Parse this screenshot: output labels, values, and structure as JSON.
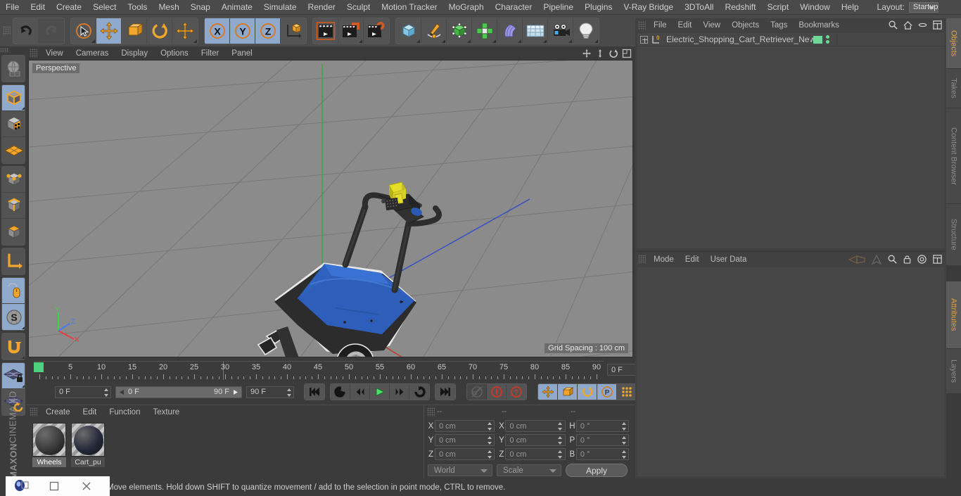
{
  "app": {
    "name": "CINEMA 4D",
    "brand": "MAXON",
    "brand_suffix": "CINEMA 4D"
  },
  "menubar": {
    "items": [
      "File",
      "Edit",
      "Create",
      "Select",
      "Tools",
      "Mesh",
      "Snap",
      "Animate",
      "Simulate",
      "Render",
      "Sculpt",
      "Motion Tracker",
      "MoGraph",
      "Character",
      "Pipeline",
      "Plugins",
      "V-Ray Bridge",
      "3DToAll",
      "Redshift",
      "Script",
      "Window",
      "Help"
    ],
    "layout_label": "Layout:",
    "layout_value": "Startup",
    "right_icons": [
      "search-icon",
      "home-icon",
      "minimize-icon",
      "maximize-icon"
    ]
  },
  "toolbar": {
    "groups": [
      {
        "name": "undo-redo",
        "buttons": [
          {
            "icon": "undo-icon",
            "label": "Undo",
            "state": "normal"
          },
          {
            "icon": "redo-icon",
            "label": "Redo",
            "state": "disabled"
          }
        ]
      },
      {
        "name": "transform-tools",
        "buttons": [
          {
            "icon": "live-selection-icon",
            "label": "Live Selection",
            "state": "normal",
            "has_corner": true
          },
          {
            "icon": "move-icon",
            "label": "Move",
            "state": "selected"
          },
          {
            "icon": "scale-icon",
            "label": "Scale",
            "state": "normal"
          },
          {
            "icon": "rotate-icon",
            "label": "Rotate",
            "state": "normal"
          },
          {
            "icon": "move-alt-icon",
            "label": "Move Tool",
            "state": "normal",
            "has_corner": true
          }
        ]
      },
      {
        "name": "axis-locks",
        "buttons": [
          {
            "icon": "axis-x-icon",
            "label": "X Axis",
            "state": "selected"
          },
          {
            "icon": "axis-y-icon",
            "label": "Y Axis",
            "state": "selected"
          },
          {
            "icon": "axis-z-icon",
            "label": "Z Axis",
            "state": "selected"
          },
          {
            "icon": "world-coordinates-icon",
            "label": "World / Object Coordinate System",
            "state": "normal"
          }
        ]
      },
      {
        "name": "render-tools",
        "buttons": [
          {
            "icon": "render-view-icon",
            "label": "Render View",
            "state": "normal"
          },
          {
            "icon": "render-region-icon",
            "label": "Render to Picture Viewer",
            "state": "normal",
            "has_corner": true
          },
          {
            "icon": "render-settings-icon",
            "label": "Edit Render Settings",
            "state": "normal"
          }
        ]
      },
      {
        "name": "create-objects",
        "buttons": [
          {
            "icon": "cube-primitive-icon",
            "label": "Add Cube Object",
            "state": "normal",
            "has_corner": true
          },
          {
            "icon": "spline-pen-icon",
            "label": "Add Spline",
            "state": "normal",
            "has_corner": true
          },
          {
            "icon": "generator-icon",
            "label": "Add Generator",
            "state": "normal",
            "has_corner": true
          },
          {
            "icon": "array-icon",
            "label": "Add Modeling Object",
            "state": "normal",
            "has_corner": true
          },
          {
            "icon": "deformer-icon",
            "label": "Add Bend Object",
            "state": "normal",
            "has_corner": true
          },
          {
            "icon": "environment-icon",
            "label": "Add Floor Object",
            "state": "normal",
            "has_corner": true
          },
          {
            "icon": "camera-icon",
            "label": "Add Camera",
            "state": "normal",
            "has_corner": true
          },
          {
            "icon": "light-icon",
            "label": "Add Light",
            "state": "normal",
            "has_corner": true
          }
        ]
      }
    ]
  },
  "left_toolbar": {
    "groups": [
      {
        "name": "viewport-modes",
        "buttons": [
          {
            "icon": "make-editable-icon",
            "label": "Make Editable",
            "state": "normal"
          }
        ]
      },
      {
        "name": "component-modes",
        "buttons": [
          {
            "icon": "model-mode-icon",
            "label": "Model Mode",
            "state": "selected",
            "has_corner": true
          },
          {
            "icon": "texture-mode-icon",
            "label": "Texture Mode",
            "state": "normal"
          },
          {
            "icon": "workplane-icon",
            "label": "Enable Workplane",
            "state": "normal"
          }
        ]
      },
      {
        "name": "element-modes",
        "buttons": [
          {
            "icon": "points-mode-icon",
            "label": "Points Mode",
            "state": "normal"
          },
          {
            "icon": "edges-mode-icon",
            "label": "Edges Mode",
            "state": "normal"
          },
          {
            "icon": "polygons-mode-icon",
            "label": "Polygons Mode",
            "state": "normal"
          }
        ]
      },
      {
        "name": "axis-mode",
        "buttons": [
          {
            "icon": "enable-axis-icon",
            "label": "Enable Axis Modification",
            "state": "normal"
          }
        ]
      },
      {
        "name": "snap-modes",
        "buttons": [
          {
            "icon": "viewport-solo-icon",
            "label": "Viewport Solo Single",
            "state": "selected"
          },
          {
            "icon": "snap-icon",
            "label": "Enable Snapping",
            "state": "selected",
            "has_corner": true
          }
        ]
      },
      {
        "name": "undo-view",
        "buttons": [
          {
            "icon": "undo-view-icon",
            "label": "Undo View",
            "state": "normal",
            "has_corner": true
          }
        ]
      },
      {
        "name": "workplane-tools",
        "buttons": [
          {
            "icon": "workplane-lock-icon",
            "label": "Lock Workplane",
            "state": "selected"
          },
          {
            "icon": "workplane-reset-icon",
            "label": "Planar Workplane Mode",
            "state": "normal"
          }
        ]
      }
    ]
  },
  "viewport": {
    "menu": [
      "View",
      "Cameras",
      "Display",
      "Options",
      "Filter",
      "Panel"
    ],
    "label": "Perspective",
    "grid_spacing": "Grid Spacing : 100 cm",
    "axis_gizmo": {
      "x": "X",
      "y": "Y",
      "z": "Z",
      "x_color": "#e04040",
      "y_color": "#3fd34a",
      "z_color": "#4a7de8"
    },
    "nav_icons": [
      "pan-icon",
      "zoom-icon",
      "rotate-view-icon",
      "maximize-view-icon"
    ],
    "scene_object": "Electric Shopping Cart Retriever",
    "colors": {
      "background": "#8b8b8b",
      "grid": "#757575",
      "body": "#2a56a8",
      "chassis": "#2b2b2b",
      "light": "#e8df3a",
      "axis_x": "#c0392b",
      "axis_y": "#3aa83a",
      "axis_z": "#3a4fc0"
    }
  },
  "timeline": {
    "ticks": [
      "0",
      "5",
      "10",
      "15",
      "20",
      "25",
      "30",
      "35",
      "40",
      "45",
      "50",
      "55",
      "60",
      "65",
      "70",
      "75",
      "80",
      "85",
      "90"
    ],
    "current_frame_field": "0 F",
    "current_frame_left": "0 F",
    "range_start": "0 F",
    "range_end": "90 F",
    "max_frame": "90 F",
    "transport": [
      {
        "icon": "go-to-start-icon",
        "label": "Go to Start",
        "state": "normal"
      },
      {
        "icon": "previous-key-icon",
        "label": "Go to Previous Key",
        "state": "normal"
      },
      {
        "icon": "previous-frame-icon",
        "label": "Go to Previous Frame",
        "state": "normal"
      },
      {
        "icon": "play-icon",
        "label": "Play Forwards",
        "state": "normal"
      },
      {
        "icon": "next-frame-icon",
        "label": "Go to Next Frame",
        "state": "normal"
      },
      {
        "icon": "next-key-icon",
        "label": "Go to Next Key",
        "state": "normal"
      },
      {
        "icon": "go-to-end-icon",
        "label": "Go to End",
        "state": "normal"
      }
    ],
    "record_group": [
      {
        "icon": "autokey-icon",
        "label": "Autokeying",
        "state": "disabled"
      },
      {
        "icon": "record-active-objects-icon",
        "label": "Record Active Objects",
        "state": "normal"
      },
      {
        "icon": "keyframe-selection-icon",
        "label": "Keyframe Selection",
        "state": "normal"
      }
    ],
    "key_toggles": [
      {
        "icon": "position-key-icon",
        "label": "Position",
        "state": "selected"
      },
      {
        "icon": "scale-key-icon",
        "label": "Scale",
        "state": "selected"
      },
      {
        "icon": "rotation-key-icon",
        "label": "Rotation",
        "state": "selected"
      },
      {
        "icon": "parameter-key-icon",
        "label": "Parameter",
        "state": "selected"
      },
      {
        "icon": "point-level-animation-icon",
        "label": "Point Level Animation",
        "state": "normal"
      }
    ],
    "timeline_toggle": {
      "icon": "timeline-icon",
      "label": "Timeline",
      "state": "selected"
    }
  },
  "material_manager": {
    "menu": [
      "Create",
      "Edit",
      "Function",
      "Texture"
    ],
    "materials": [
      {
        "name": "Wheels",
        "selected": true,
        "color": "#3a3a3a"
      },
      {
        "name": "Cart_pu",
        "selected": false,
        "color": "#25293a"
      }
    ]
  },
  "coordinates": {
    "headers": [
      "--",
      "--",
      "--"
    ],
    "rows": [
      {
        "l1": "X",
        "v1": "0 cm",
        "l2": "X",
        "v2": "0 cm",
        "l3": "H",
        "v3": "0 °"
      },
      {
        "l1": "Y",
        "v1": "0 cm",
        "l2": "Y",
        "v2": "0 cm",
        "l3": "P",
        "v3": "0 °"
      },
      {
        "l1": "Z",
        "v1": "0 cm",
        "l2": "Z",
        "v2": "0 cm",
        "l3": "B",
        "v3": "0 °"
      }
    ],
    "system": "World",
    "mode": "Scale",
    "apply": "Apply"
  },
  "object_manager": {
    "menu": [
      "File",
      "Edit",
      "View",
      "Objects",
      "Tags",
      "Bookmarks"
    ],
    "head_icons": [
      "search-icon",
      "home-icon",
      "minimize-icon",
      "maximize-icon"
    ],
    "objects": [
      {
        "name": "Electric_Shopping_Cart_Retriever_New",
        "layer": "0",
        "tag_color": "#6fd69a"
      }
    ]
  },
  "attributes_manager": {
    "menu": [
      "Mode",
      "Edit",
      "User Data"
    ],
    "head_icons": [
      "prev-nav-icon",
      "next-nav-icon",
      "search-icon",
      "lock-icon",
      "target-icon",
      "maximize-icon"
    ]
  },
  "right_tabs": {
    "upper": [
      {
        "label": "Objects",
        "active": true
      },
      {
        "label": "Takes",
        "active": false
      },
      {
        "label": "Content Browser",
        "active": false
      },
      {
        "label": "Structure",
        "active": false
      }
    ],
    "lower": [
      {
        "label": "Attributes",
        "active": true
      },
      {
        "label": "Layers",
        "active": false
      }
    ]
  },
  "statusbar": {
    "text": "Move elements. Hold down SHIFT to quantize movement / add to the selection in point mode, CTRL to remove."
  },
  "taskbar": {
    "buttons": [
      "app-icon",
      "minimize-icon",
      "close-icon"
    ]
  }
}
